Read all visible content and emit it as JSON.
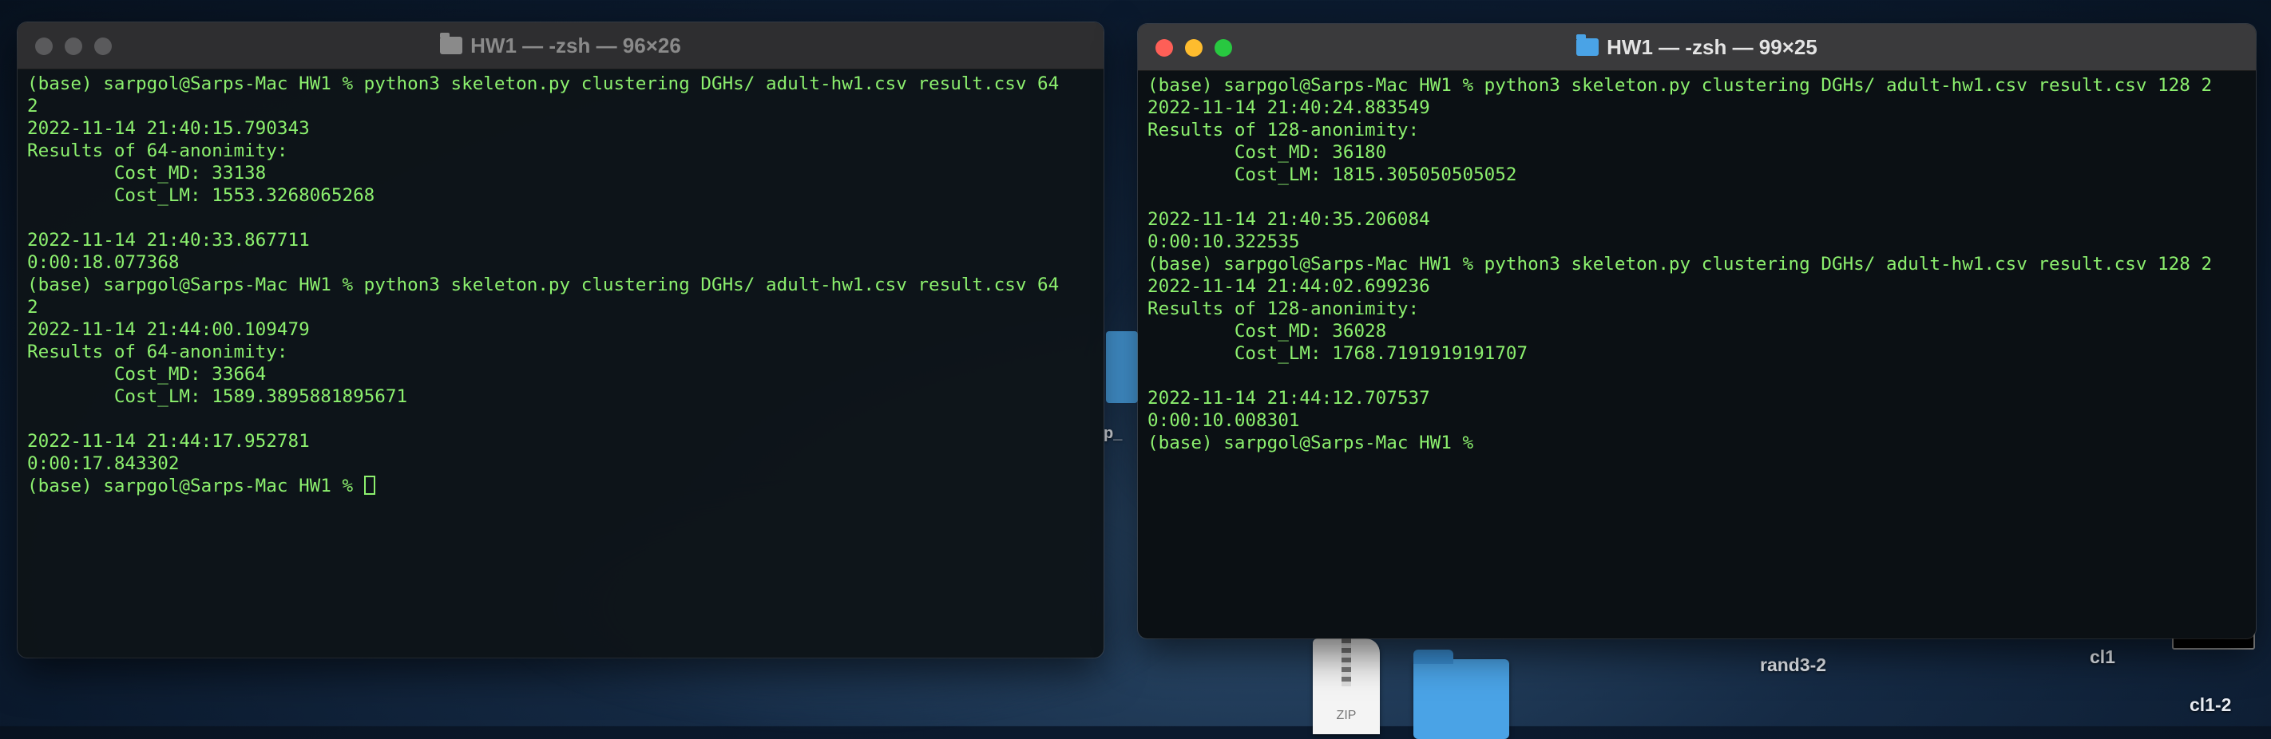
{
  "desktop": {
    "icons": [
      {
        "label": "rand3-2",
        "kind": "file"
      },
      {
        "label": "cl1",
        "kind": "file"
      },
      {
        "label": "cl1-2",
        "kind": "file"
      },
      {
        "label": "ZIP",
        "kind": "zip"
      },
      {
        "label": "p_",
        "kind": "folder"
      }
    ]
  },
  "left_window": {
    "title": "HW1 — -zsh — 96×26",
    "lines": [
      "(base) sarpgol@Sarps-Mac HW1 % python3 skeleton.py clustering DGHs/ adult-hw1.csv result.csv 64",
      "2",
      "2022-11-14 21:40:15.790343",
      "Results of 64-anonimity:",
      "        Cost_MD: 33138",
      "        Cost_LM: 1553.3268065268",
      "",
      "2022-11-14 21:40:33.867711",
      "0:00:18.077368",
      "(base) sarpgol@Sarps-Mac HW1 % python3 skeleton.py clustering DGHs/ adult-hw1.csv result.csv 64",
      "2",
      "2022-11-14 21:44:00.109479",
      "Results of 64-anonimity:",
      "        Cost_MD: 33664",
      "        Cost_LM: 1589.3895881895671",
      "",
      "2022-11-14 21:44:17.952781",
      "0:00:17.843302"
    ],
    "prompt": "(base) sarpgol@Sarps-Mac HW1 % "
  },
  "right_window": {
    "title": "HW1 — -zsh — 99×25",
    "lines": [
      "(base) sarpgol@Sarps-Mac HW1 % python3 skeleton.py clustering DGHs/ adult-hw1.csv result.csv 128 2",
      "2022-11-14 21:40:24.883549",
      "Results of 128-anonimity:",
      "        Cost_MD: 36180",
      "        Cost_LM: 1815.305050505052",
      "",
      "2022-11-14 21:40:35.206084",
      "0:00:10.322535",
      "(base) sarpgol@Sarps-Mac HW1 % python3 skeleton.py clustering DGHs/ adult-hw1.csv result.csv 128 2",
      "2022-11-14 21:44:02.699236",
      "Results of 128-anonimity:",
      "        Cost_MD: 36028",
      "        Cost_LM: 1768.7191919191707",
      "",
      "2022-11-14 21:44:12.707537",
      "0:00:10.008301"
    ],
    "prompt": "(base) sarpgol@Sarps-Mac HW1 %"
  },
  "colors": {
    "terminal_text": "#8cf06e",
    "terminal_bg": "#0b1014",
    "close": "#fe5f57",
    "minimize": "#febc2e",
    "zoom": "#28c840"
  }
}
